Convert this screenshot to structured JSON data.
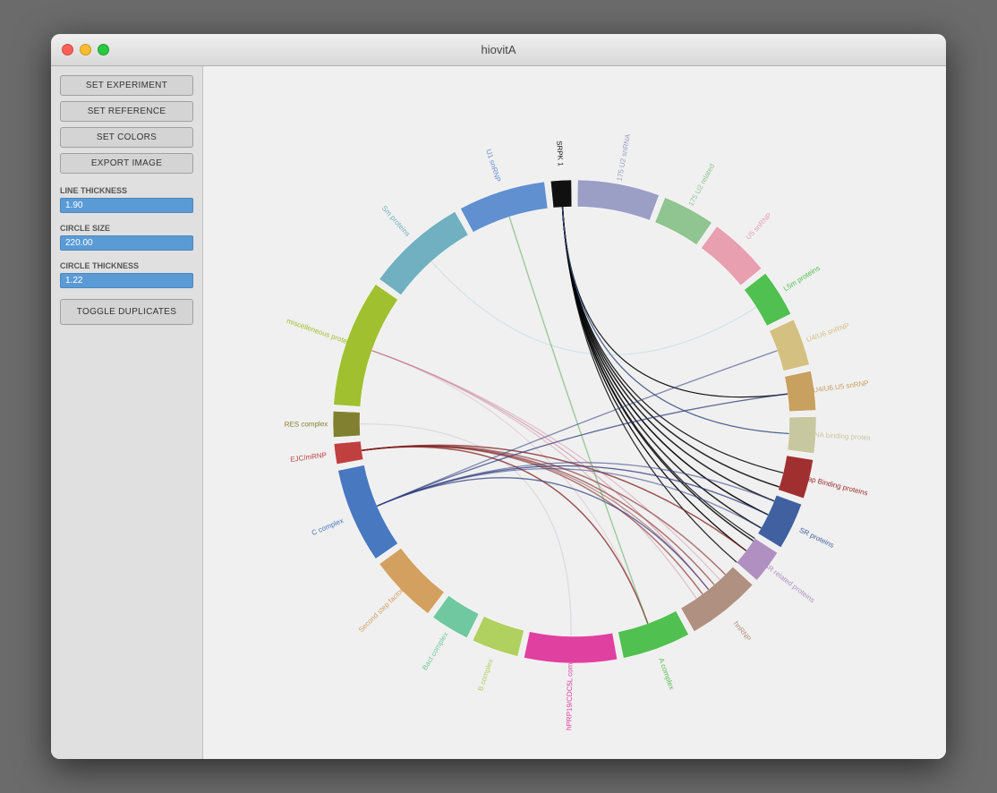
{
  "window": {
    "title": "hiovitA"
  },
  "sidebar": {
    "set_experiment": "SET EXPERIMENT",
    "set_reference": "SET REFERENCE",
    "set_colors": "SET COLORS",
    "export_image": "EXPORT IMAGE",
    "line_thickness_label": "LINE THICKNESS",
    "line_thickness_value": "1.90",
    "circle_size_label": "CIRCLE SIZE",
    "circle_size_value": "220.00",
    "circle_thickness_label": "CIRCLE THICKNESS",
    "circle_thickness_value": "1.22",
    "toggle_duplicates": "TOGGLE DUPLICATES"
  },
  "segments": [
    {
      "label": "175 U2 snRNA",
      "color": "#9b9ec5",
      "angle_start": 85,
      "angle_end": 118
    },
    {
      "label": "175 U2 related",
      "color": "#90c490",
      "angle_start": 118,
      "angle_end": 140
    },
    {
      "label": "U5 snRNP",
      "color": "#e8a0b0",
      "angle_start": 140,
      "angle_end": 165
    },
    {
      "label": "L5m proteins",
      "color": "#50c050",
      "angle_start": 165,
      "angle_end": 185
    },
    {
      "label": "U4/U6 snRNP",
      "color": "#d4c080",
      "angle_start": 185,
      "angle_end": 205
    },
    {
      "label": "U4/U6.U5 snRNP",
      "color": "#c8a060",
      "angle_start": 205,
      "angle_end": 222
    },
    {
      "label": "RNA binding proteins",
      "color": "#c8c8a0",
      "angle_start": 222,
      "angle_end": 238
    },
    {
      "label": "Cap Binding proteins",
      "color": "#a03030",
      "angle_start": 238,
      "angle_end": 255
    },
    {
      "label": "SR proteins",
      "color": "#4060a0",
      "angle_start": 255,
      "angle_end": 275
    },
    {
      "label": "SR related proteins",
      "color": "#b090c0",
      "angle_start": 275,
      "angle_end": 290
    },
    {
      "label": "hnRNP",
      "color": "#b09080",
      "angle_start": 290,
      "angle_end": 320
    },
    {
      "label": "A complex",
      "color": "#50c050",
      "angle_start": 320,
      "angle_end": 348
    },
    {
      "label": "hPRP19/CDC5L complex",
      "color": "#e040a0",
      "angle_start": 348,
      "angle_end": 385
    },
    {
      "label": "B complex",
      "color": "#b0d060",
      "angle_start": 385,
      "angle_end": 405
    },
    {
      "label": "Bact complex",
      "color": "#70c8a0",
      "angle_start": 405,
      "angle_end": 422
    },
    {
      "label": "Second step factors",
      "color": "#d4a060",
      "angle_start": 422,
      "angle_end": 450
    },
    {
      "label": "C complex",
      "color": "#4878c0",
      "angle_start": 450,
      "angle_end": 488
    },
    {
      "label": "EJC/mRNP",
      "color": "#c04040",
      "angle_start": 488,
      "angle_end": 498
    },
    {
      "label": "RES complex",
      "color": "#808030",
      "angle_start": 498,
      "angle_end": 510
    },
    {
      "label": "miscelleneous proteins",
      "color": "#a0c030",
      "angle_start": 510,
      "angle_end": 560
    },
    {
      "label": "Sm proteins",
      "color": "#70b0c0",
      "angle_start": 560,
      "angle_end": 600
    },
    {
      "label": "U1 snRNP",
      "color": "#6090d0",
      "angle_start": 600,
      "angle_end": 635
    },
    {
      "label": "SRPK 1",
      "color": "#101010",
      "angle_start": 635,
      "angle_end": 645
    }
  ]
}
